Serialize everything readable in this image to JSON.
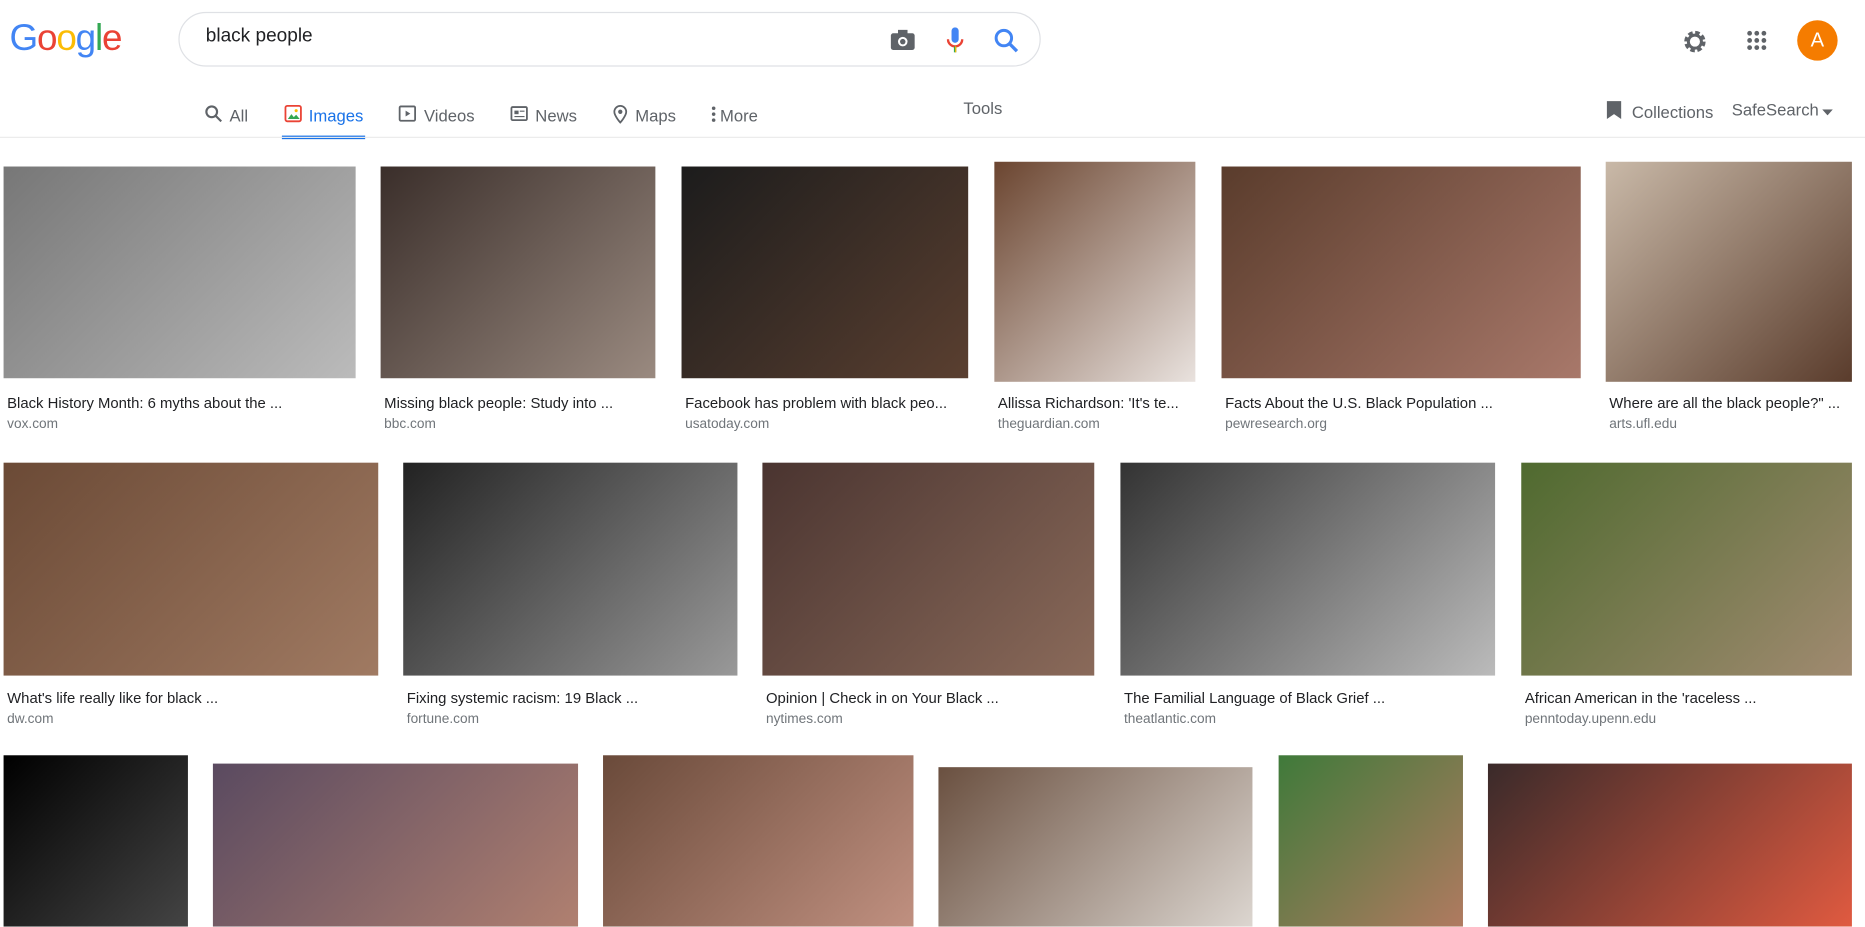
{
  "logo": "Google",
  "search": {
    "query": "black people"
  },
  "header": {
    "avatar_letter": "A",
    "avatar_color": "#f57c00"
  },
  "tabs": [
    {
      "label": "All",
      "icon": "search-icon"
    },
    {
      "label": "Images",
      "icon": "image-icon",
      "active": true
    },
    {
      "label": "Videos",
      "icon": "video-icon"
    },
    {
      "label": "News",
      "icon": "news-icon"
    },
    {
      "label": "Maps",
      "icon": "map-pin-icon"
    },
    {
      "label": "More",
      "icon": "more-vert-icon"
    }
  ],
  "tools_label": "Tools",
  "collections_label": "Collections",
  "safesearch_label": "SafeSearch",
  "results": [
    {
      "title": "Black History Month: 6 myths about the ...",
      "source": "vox.com"
    },
    {
      "title": "Missing black people: Study into ...",
      "source": "bbc.com"
    },
    {
      "title": "Facebook has problem with black peo...",
      "source": "usatoday.com"
    },
    {
      "title": "Allissa Richardson: 'It's te...",
      "source": "theguardian.com"
    },
    {
      "title": "Facts About the U.S. Black Population ...",
      "source": "pewresearch.org"
    },
    {
      "title": "Where are all the black people?\" ...",
      "source": "arts.ufl.edu"
    },
    {
      "title": "What's life really like for black ...",
      "source": "dw.com"
    },
    {
      "title": "Fixing systemic racism: 19 Black ...",
      "source": "fortune.com"
    },
    {
      "title": "Opinion | Check in on Your Black ...",
      "source": "nytimes.com"
    },
    {
      "title": "The Familial Language of Black Grief ...",
      "source": "theatlantic.com"
    },
    {
      "title": "African American in the 'raceless ...",
      "source": "penntoday.upenn.edu"
    }
  ]
}
